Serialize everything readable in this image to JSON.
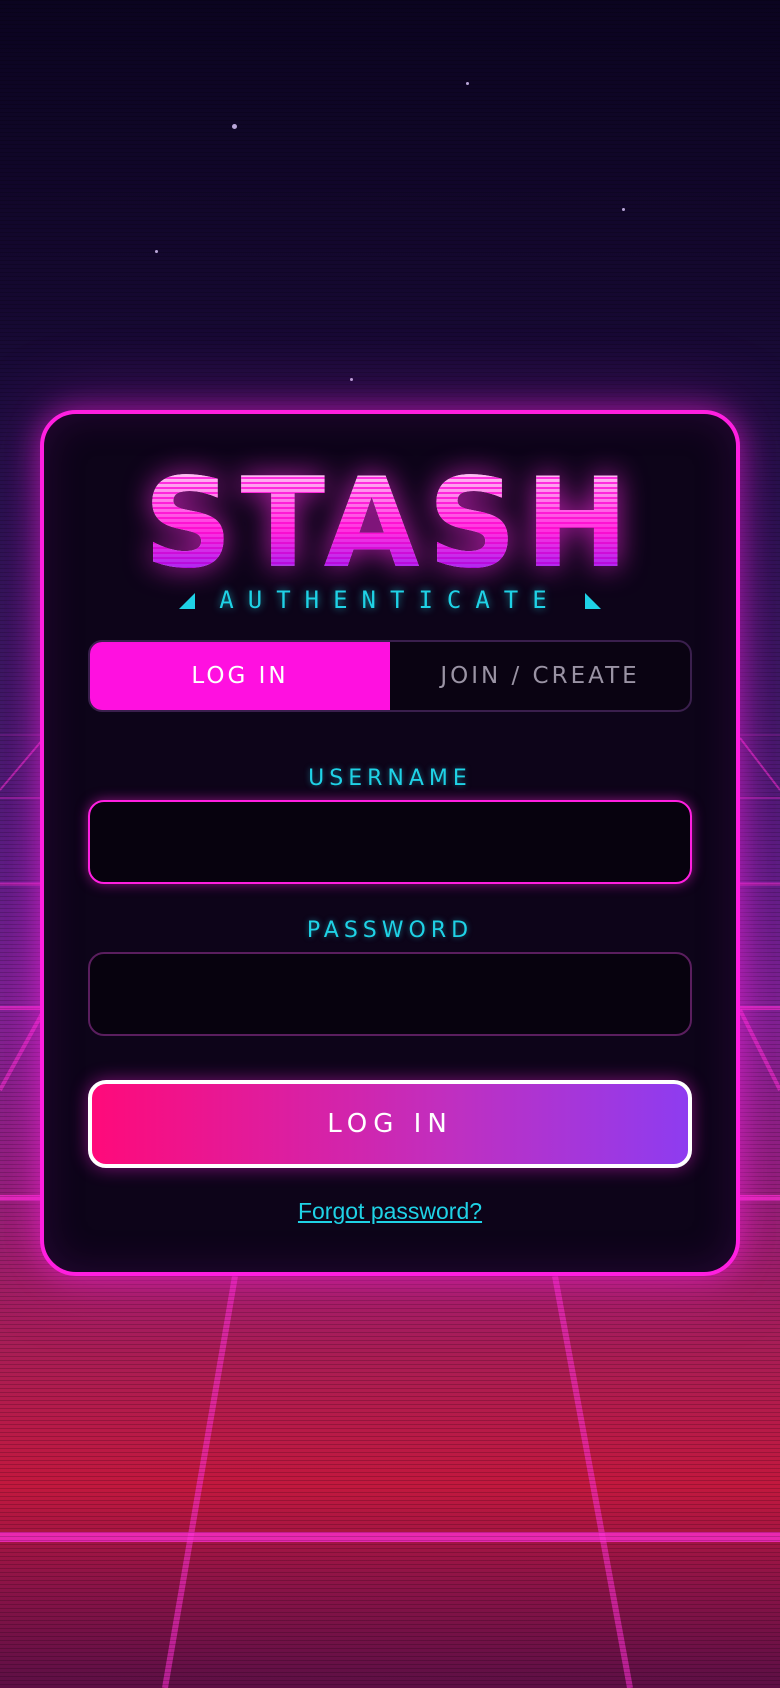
{
  "logo": {
    "text": "STASH"
  },
  "subtitle": "AUTHENTICATE",
  "tabs": [
    {
      "label": "LOG IN",
      "active": true
    },
    {
      "label": "JOIN / CREATE",
      "active": false
    }
  ],
  "form": {
    "username_label": "USERNAME",
    "username_value": "",
    "password_label": "PASSWORD",
    "password_value": "",
    "submit_label": "LOG IN",
    "forgot_link": "Forgot password?"
  },
  "colors": {
    "accent_pink": "#ff1fe0",
    "accent_cyan": "#1fd2e6",
    "card_bg": "#0d0419"
  }
}
